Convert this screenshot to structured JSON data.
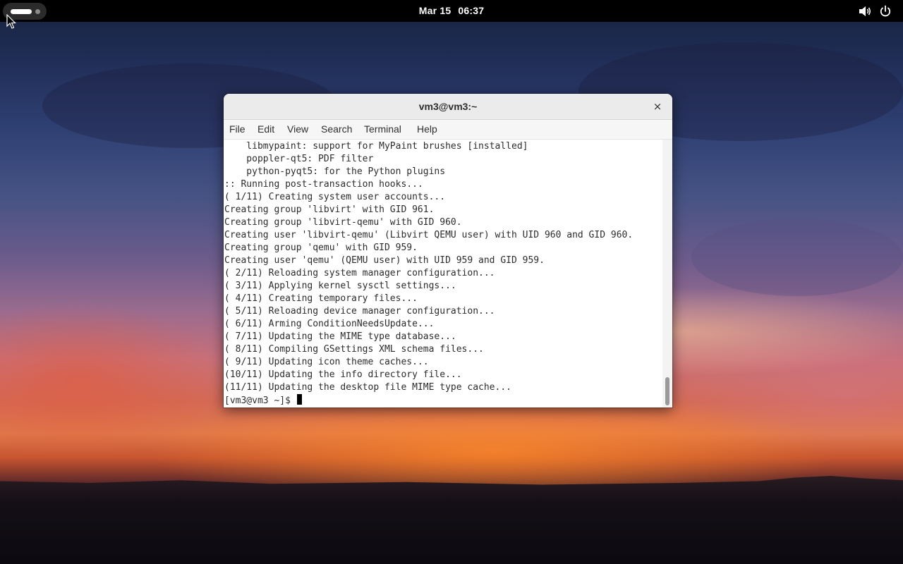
{
  "topbar": {
    "date": "Mar 15",
    "time": "06:37",
    "icons": [
      "activities-indicator-icon",
      "volume-icon",
      "power-icon"
    ]
  },
  "terminal": {
    "title": "vm3@vm3:~",
    "close_label": "×",
    "menu": [
      "File",
      "Edit",
      "View",
      "Search",
      "Terminal",
      "Help"
    ],
    "lines": [
      "    libmypaint: support for MyPaint brushes [installed]",
      "    poppler-qt5: PDF filter",
      "    python-pyqt5: for the Python plugins",
      ":: Running post-transaction hooks...",
      "( 1/11) Creating system user accounts...",
      "Creating group 'libvirt' with GID 961.",
      "Creating group 'libvirt-qemu' with GID 960.",
      "Creating user 'libvirt-qemu' (Libvirt QEMU user) with UID 960 and GID 960.",
      "Creating group 'qemu' with GID 959.",
      "Creating user 'qemu' (QEMU user) with UID 959 and GID 959.",
      "( 2/11) Reloading system manager configuration...",
      "( 3/11) Applying kernel sysctl settings...",
      "( 4/11) Creating temporary files...",
      "( 5/11) Reloading device manager configuration...",
      "( 6/11) Arming ConditionNeedsUpdate...",
      "( 7/11) Updating the MIME type database...",
      "( 8/11) Compiling GSettings XML schema files...",
      "( 9/11) Updating icon theme caches...",
      "(10/11) Updating the info directory file...",
      "(11/11) Updating the desktop file MIME type cache..."
    ],
    "prompt": "[vm3@vm3 ~]$ ",
    "scroll_position": 1.0
  },
  "colors": {
    "topbar_bg": "#000000",
    "titlebar_bg": "#ebebeb",
    "terminal_bg": "#ffffff",
    "terminal_fg": "#2c2c2c"
  }
}
